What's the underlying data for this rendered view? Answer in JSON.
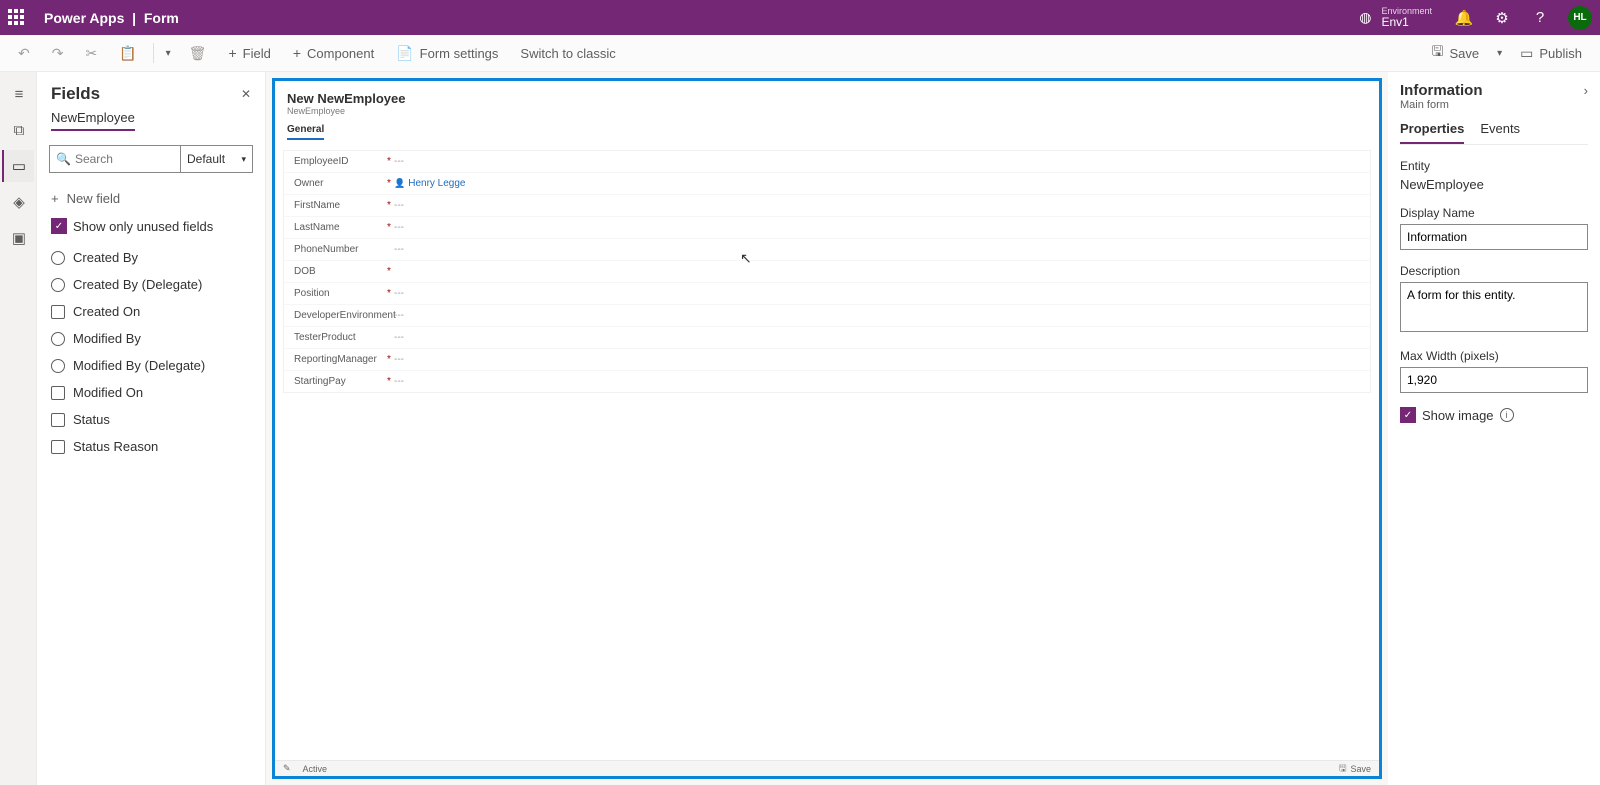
{
  "header": {
    "appName": "Power Apps",
    "sep": "|",
    "page": "Form",
    "envLabel": "Environment",
    "envName": "Env1",
    "avatar": "HL"
  },
  "cmd": {
    "field": "Field",
    "component": "Component",
    "formSettings": "Form settings",
    "switch": "Switch to classic",
    "save": "Save",
    "publish": "Publish"
  },
  "fieldsPane": {
    "title": "Fields",
    "entity": "NewEmployee",
    "searchPlaceholder": "Search",
    "sort": "Default",
    "newField": "New field",
    "showUnused": "Show only unused fields",
    "items": [
      {
        "icon": "round",
        "label": "Created By"
      },
      {
        "icon": "round",
        "label": "Created By (Delegate)"
      },
      {
        "icon": "box",
        "label": "Created On"
      },
      {
        "icon": "round",
        "label": "Modified By"
      },
      {
        "icon": "round",
        "label": "Modified By (Delegate)"
      },
      {
        "icon": "box",
        "label": "Modified On"
      },
      {
        "icon": "box",
        "label": "Status"
      },
      {
        "icon": "box",
        "label": "Status Reason"
      }
    ]
  },
  "form": {
    "title": "New NewEmployee",
    "entity": "NewEmployee",
    "tab": "General",
    "rows": [
      {
        "label": "EmployeeID",
        "required": true,
        "value": "---"
      },
      {
        "label": "Owner",
        "required": true,
        "value": "Henry Legge",
        "link": true
      },
      {
        "label": "FirstName",
        "required": true,
        "value": "---"
      },
      {
        "label": "LastName",
        "required": true,
        "value": "---"
      },
      {
        "label": "PhoneNumber",
        "required": false,
        "value": "---"
      },
      {
        "label": "DOB",
        "required": true,
        "value": ""
      },
      {
        "label": "Position",
        "required": true,
        "value": "---"
      },
      {
        "label": "DeveloperEnvironment",
        "required": false,
        "value": "---"
      },
      {
        "label": "TesterProduct",
        "required": false,
        "value": "---"
      },
      {
        "label": "ReportingManager",
        "required": true,
        "value": "---"
      },
      {
        "label": "StartingPay",
        "required": true,
        "value": "---"
      }
    ],
    "footer": {
      "status": "Active",
      "save": "Save"
    }
  },
  "props": {
    "heading": "Information",
    "sub": "Main form",
    "tabs": {
      "properties": "Properties",
      "events": "Events"
    },
    "entityLbl": "Entity",
    "entityVal": "NewEmployee",
    "dispLbl": "Display Name",
    "dispVal": "Information",
    "descLbl": "Description",
    "descVal": "A form for this entity.",
    "mwLbl": "Max Width (pixels)",
    "mwVal": "1,920",
    "showImg": "Show image"
  }
}
